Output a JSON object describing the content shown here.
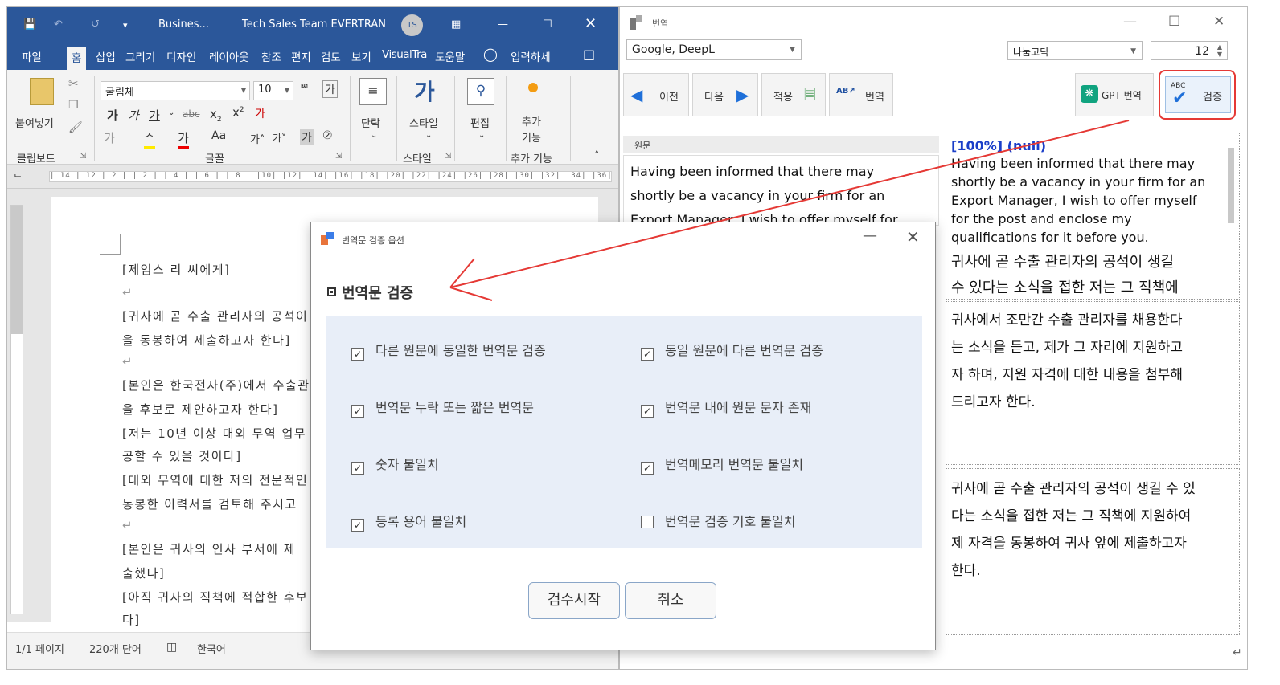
{
  "colors": {
    "word_blue": "#2b579a",
    "panel_bg": "#e8eef8",
    "annotation_red": "#e53935",
    "gpt_green": "#10a37f"
  },
  "word": {
    "title_doc": "Busines...",
    "title_team": "Tech Sales Team EVERTRAN",
    "avatar": "TS",
    "tabs": [
      "파일",
      "홈",
      "삽입",
      "그리기",
      "디자인",
      "레이아웃",
      "참조",
      "편지",
      "검토",
      "보기",
      "VisualTra",
      "도움말",
      "입력하세"
    ],
    "ribbon": {
      "paste": "붙여넣기",
      "clipboard": "클립보드",
      "font_name": "굴림체",
      "font_size": "10",
      "font_group": "글꼴",
      "paragraph": "단락",
      "styles": "스타일",
      "styles_group": "스타일",
      "editing": "편집",
      "addins": "추가\n기능",
      "addins_group": "추가 기능"
    },
    "ruler": "| 14 | 12 | 2 | | 2 | | 4 | | 6 | | 8 | |10| |12| |14| |16| |18| |20| |22| |24| |26| |28| |30| |32| |34| |36|",
    "doc_lines": [
      "[제임스 리 씨에게]",
      "",
      "[귀사에 곧 수출 관리자의 공석이",
      " 을 동봉하여 제출하고자 한다]",
      "",
      "[본인은 한국전자(주)에서 수출관",
      " 을 후보로 제안하고자 한다]",
      "[저는 10년 이상 대외 무역 업무",
      " 공할 수 있을 것이다]",
      "[대외 무역에 대한 저의 전문적인",
      " 동봉한 이력서를 검토해 주시고",
      "",
      "[본인은 귀사의 인사 부서에 제",
      " 출했다]",
      "[아직 귀사의 직책에 적합한 후보",
      " 다]"
    ],
    "status": {
      "page": "1/1 페이지",
      "words": "220개 단어",
      "lang": "한국어"
    }
  },
  "translator": {
    "title": "번역",
    "engine": "Google, DeepL",
    "font": "나눔고딕",
    "font_size": "12",
    "buttons": {
      "prev": "이전",
      "next": "다음",
      "apply": "적용",
      "translate": "번역",
      "gpt": "GPT 번역",
      "verify": "검증"
    },
    "source_header": "원문",
    "source_text": [
      "Having been informed that there may",
      "shortly be a vacancy in your firm for an",
      "Export Manager, I wish to offer myself for"
    ],
    "target1_tag": "[100%] (null)",
    "target1": [
      "Having been informed that there may",
      "shortly be a vacancy in your firm for an",
      "Export Manager, I wish to offer myself",
      "for the post and enclose my",
      "qualifications for it before you.",
      "귀사에 곧 수출 관리자의 공석이 생길",
      "수 있다는 소식을 접한 저는 그 직책에"
    ],
    "target2": [
      "귀사에서 조만간 수출 관리자를 채용한다",
      "는 소식을 듣고, 제가 그 자리에 지원하고",
      "자 하며, 지원 자격에 대한 내용을 첨부해",
      "드리고자 한다."
    ],
    "target3": [
      "귀사에 곧 수출 관리자의 공석이 생길 수 있",
      "다는 소식을 접한 저는 그 직책에 지원하여",
      "제 자격을 동봉하여 귀사 앞에 제출하고자",
      "한다."
    ]
  },
  "dialog": {
    "title": "번역문 검증 옵션",
    "section": "번역문 검증",
    "options": [
      {
        "label": "다른 원문에 동일한 번역문 검증",
        "checked": true
      },
      {
        "label": "동일 원문에 다른 번역문 검증",
        "checked": true
      },
      {
        "label": "번역문 누락 또는 짧은 번역문",
        "checked": true
      },
      {
        "label": "번역문 내에 원문 문자 존재",
        "checked": true
      },
      {
        "label": "숫자 불일치",
        "checked": true
      },
      {
        "label": "번역메모리 번역문 불일치",
        "checked": true
      },
      {
        "label": "등록 용어 불일치",
        "checked": true
      },
      {
        "label": "번역문 검증 기호 불일치",
        "checked": false
      }
    ],
    "start": "검수시작",
    "cancel": "취소"
  }
}
